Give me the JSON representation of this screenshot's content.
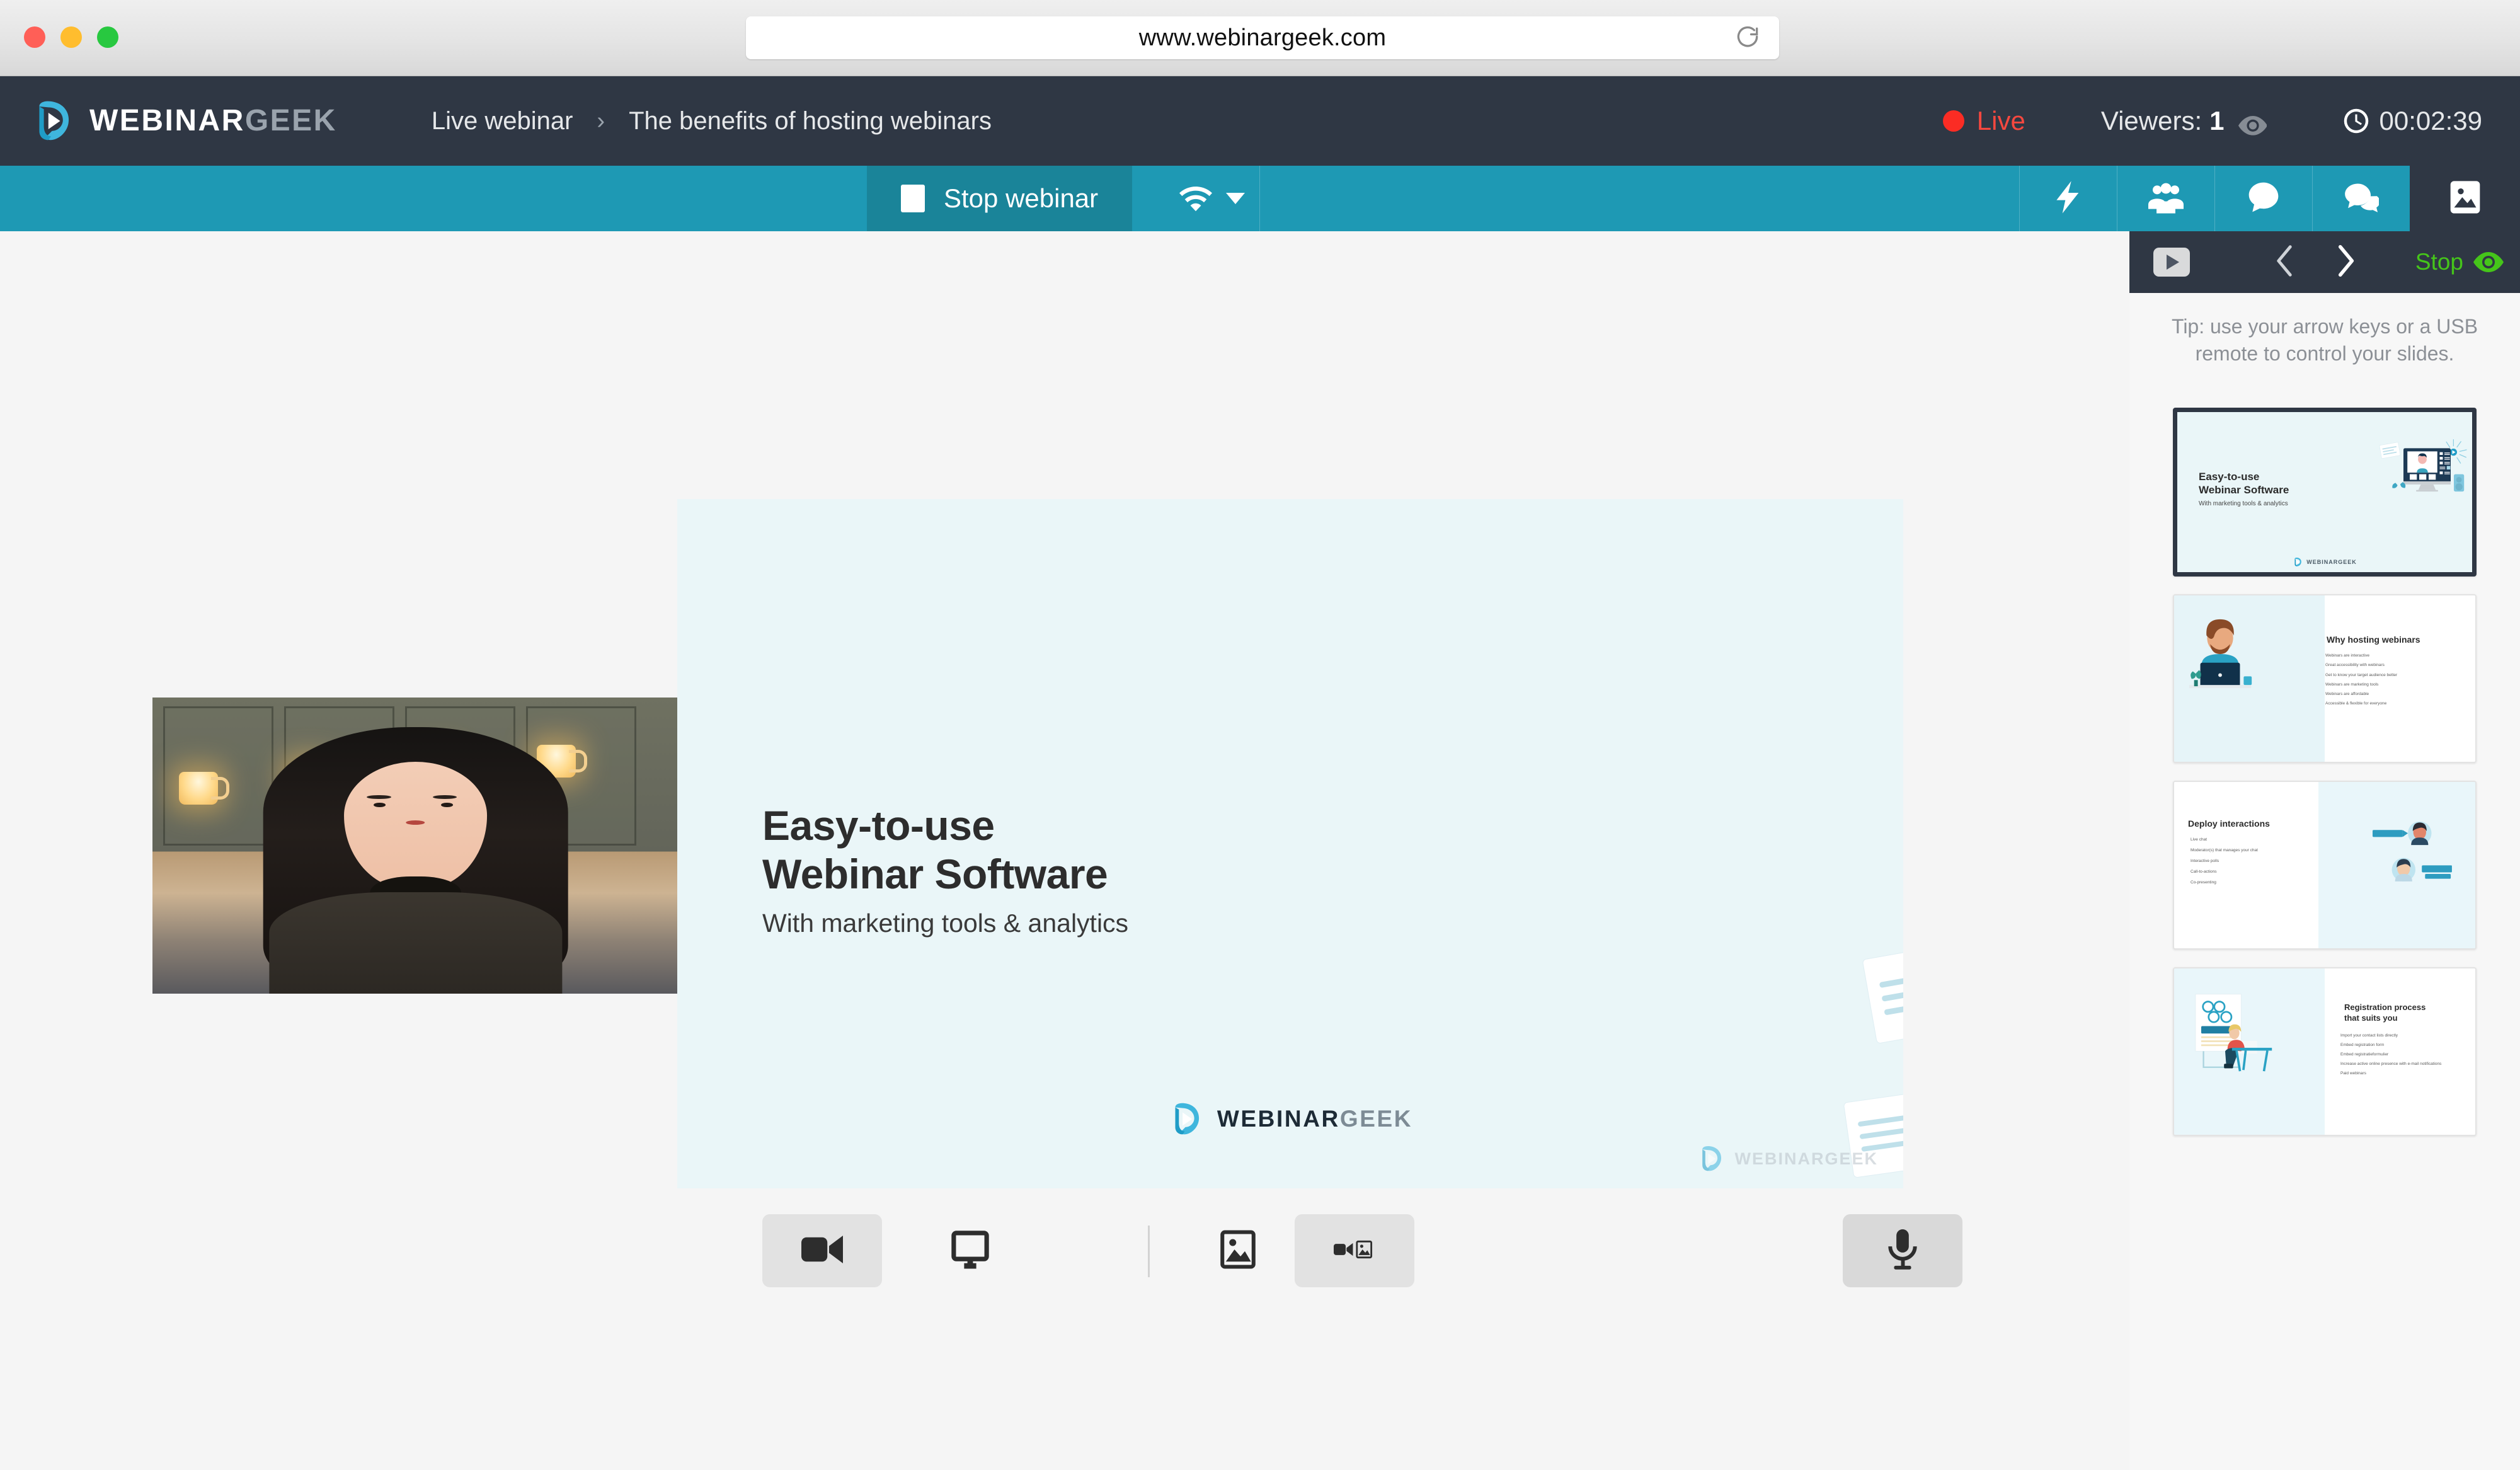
{
  "browser": {
    "url": "www.webinargeek.com",
    "reload_icon": "reload-icon",
    "traffic_lights": [
      "close",
      "minimize",
      "zoom"
    ]
  },
  "header": {
    "logo_primary": "WEBINAR",
    "logo_secondary": "GEEK",
    "breadcrumb": {
      "root": "Live webinar",
      "separator": "›",
      "current": "The benefits of hosting webinars"
    },
    "status": {
      "live_label": "Live",
      "viewers_label": "Viewers:",
      "viewers_count": "1",
      "timer": "00:02:39",
      "live_color": "#f6483f",
      "eye_icon": "eye-icon",
      "clock_icon": "clock-icon"
    }
  },
  "toolbar": {
    "background": "#1e99b4",
    "stop_webinar_label": "Stop webinar",
    "stop_icon": "stop-square-icon",
    "connection_icon": "wifi-icon",
    "connection_caret": "chevron-down-icon",
    "actions": [
      {
        "name": "interactions",
        "icon": "lightning-bolt-icon"
      },
      {
        "name": "participants",
        "icon": "people-group-icon"
      },
      {
        "name": "chat",
        "icon": "chat-bubble-icon"
      },
      {
        "name": "questions",
        "icon": "chat-bubbles-icon"
      }
    ],
    "presentation_tab_icon": "image-icon"
  },
  "stage": {
    "webcam": {
      "label": "presenter-webcam"
    },
    "slide": {
      "heading_line1": "Easy-to-use",
      "heading_line2": "Webinar Software",
      "subtitle": "With marketing tools & analytics",
      "logo_primary": "WEBINAR",
      "logo_secondary": "GEEK",
      "watermark": "WEBINARGEEK",
      "background": "#eaf6f8"
    },
    "controls": [
      {
        "name": "camera-source-button",
        "icon": "video-camera-icon",
        "active": true
      },
      {
        "name": "screen-share-button",
        "icon": "monitor-icon",
        "active": false
      },
      {
        "name": "presentation-only-button",
        "icon": "image-icon",
        "active": false
      },
      {
        "name": "camera-and-presentation-button",
        "icon": "video-camera-and-image-icon",
        "active": true
      }
    ],
    "microphone": {
      "name": "microphone-button",
      "icon": "microphone-icon"
    }
  },
  "sidebar": {
    "video_button_icon": "youtube-play-icon",
    "prev_icon": "chevron-left-icon",
    "next_icon": "chevron-right-icon",
    "stop_label": "Stop",
    "stop_color": "#45c51a",
    "stop_eye_icon": "eye-icon",
    "tip": "Tip: use your arrow keys or a USB remote to control your slides.",
    "slides": [
      {
        "index": 1,
        "active": true,
        "title_line1": "Easy-to-use",
        "title_line2": "Webinar Software",
        "subtitle": "With marketing tools & analytics",
        "footer_logo": "WEBINARGEEK",
        "bullets": []
      },
      {
        "index": 2,
        "active": false,
        "title_line1": "Why hosting webinars",
        "title_line2": "",
        "subtitle": "",
        "footer_logo": "",
        "bullets": [
          "Webinars are interactive",
          "Great accessibility with webinars",
          "Get to know your target audience better",
          "Webinars are marketing tools",
          "Webinars are affordable",
          "Accessible & flexible for everyone"
        ]
      },
      {
        "index": 3,
        "active": false,
        "title_line1": "Deploy interactions",
        "title_line2": "",
        "subtitle": "",
        "footer_logo": "",
        "bullets": [
          "Live chat",
          "Moderator(s) that manages your chat",
          "Interactive polls",
          "Call-to-actions",
          "Co-presenting"
        ]
      },
      {
        "index": 4,
        "active": false,
        "title_line1": "Registration process",
        "title_line2": "that suits you",
        "subtitle": "",
        "footer_logo": "",
        "bullets": [
          "Import your contact lists directly",
          "Embed registration form",
          "Embed registratieformulier",
          "Increase active online presence with e-mail notifications",
          "Paid webinars"
        ]
      }
    ]
  }
}
